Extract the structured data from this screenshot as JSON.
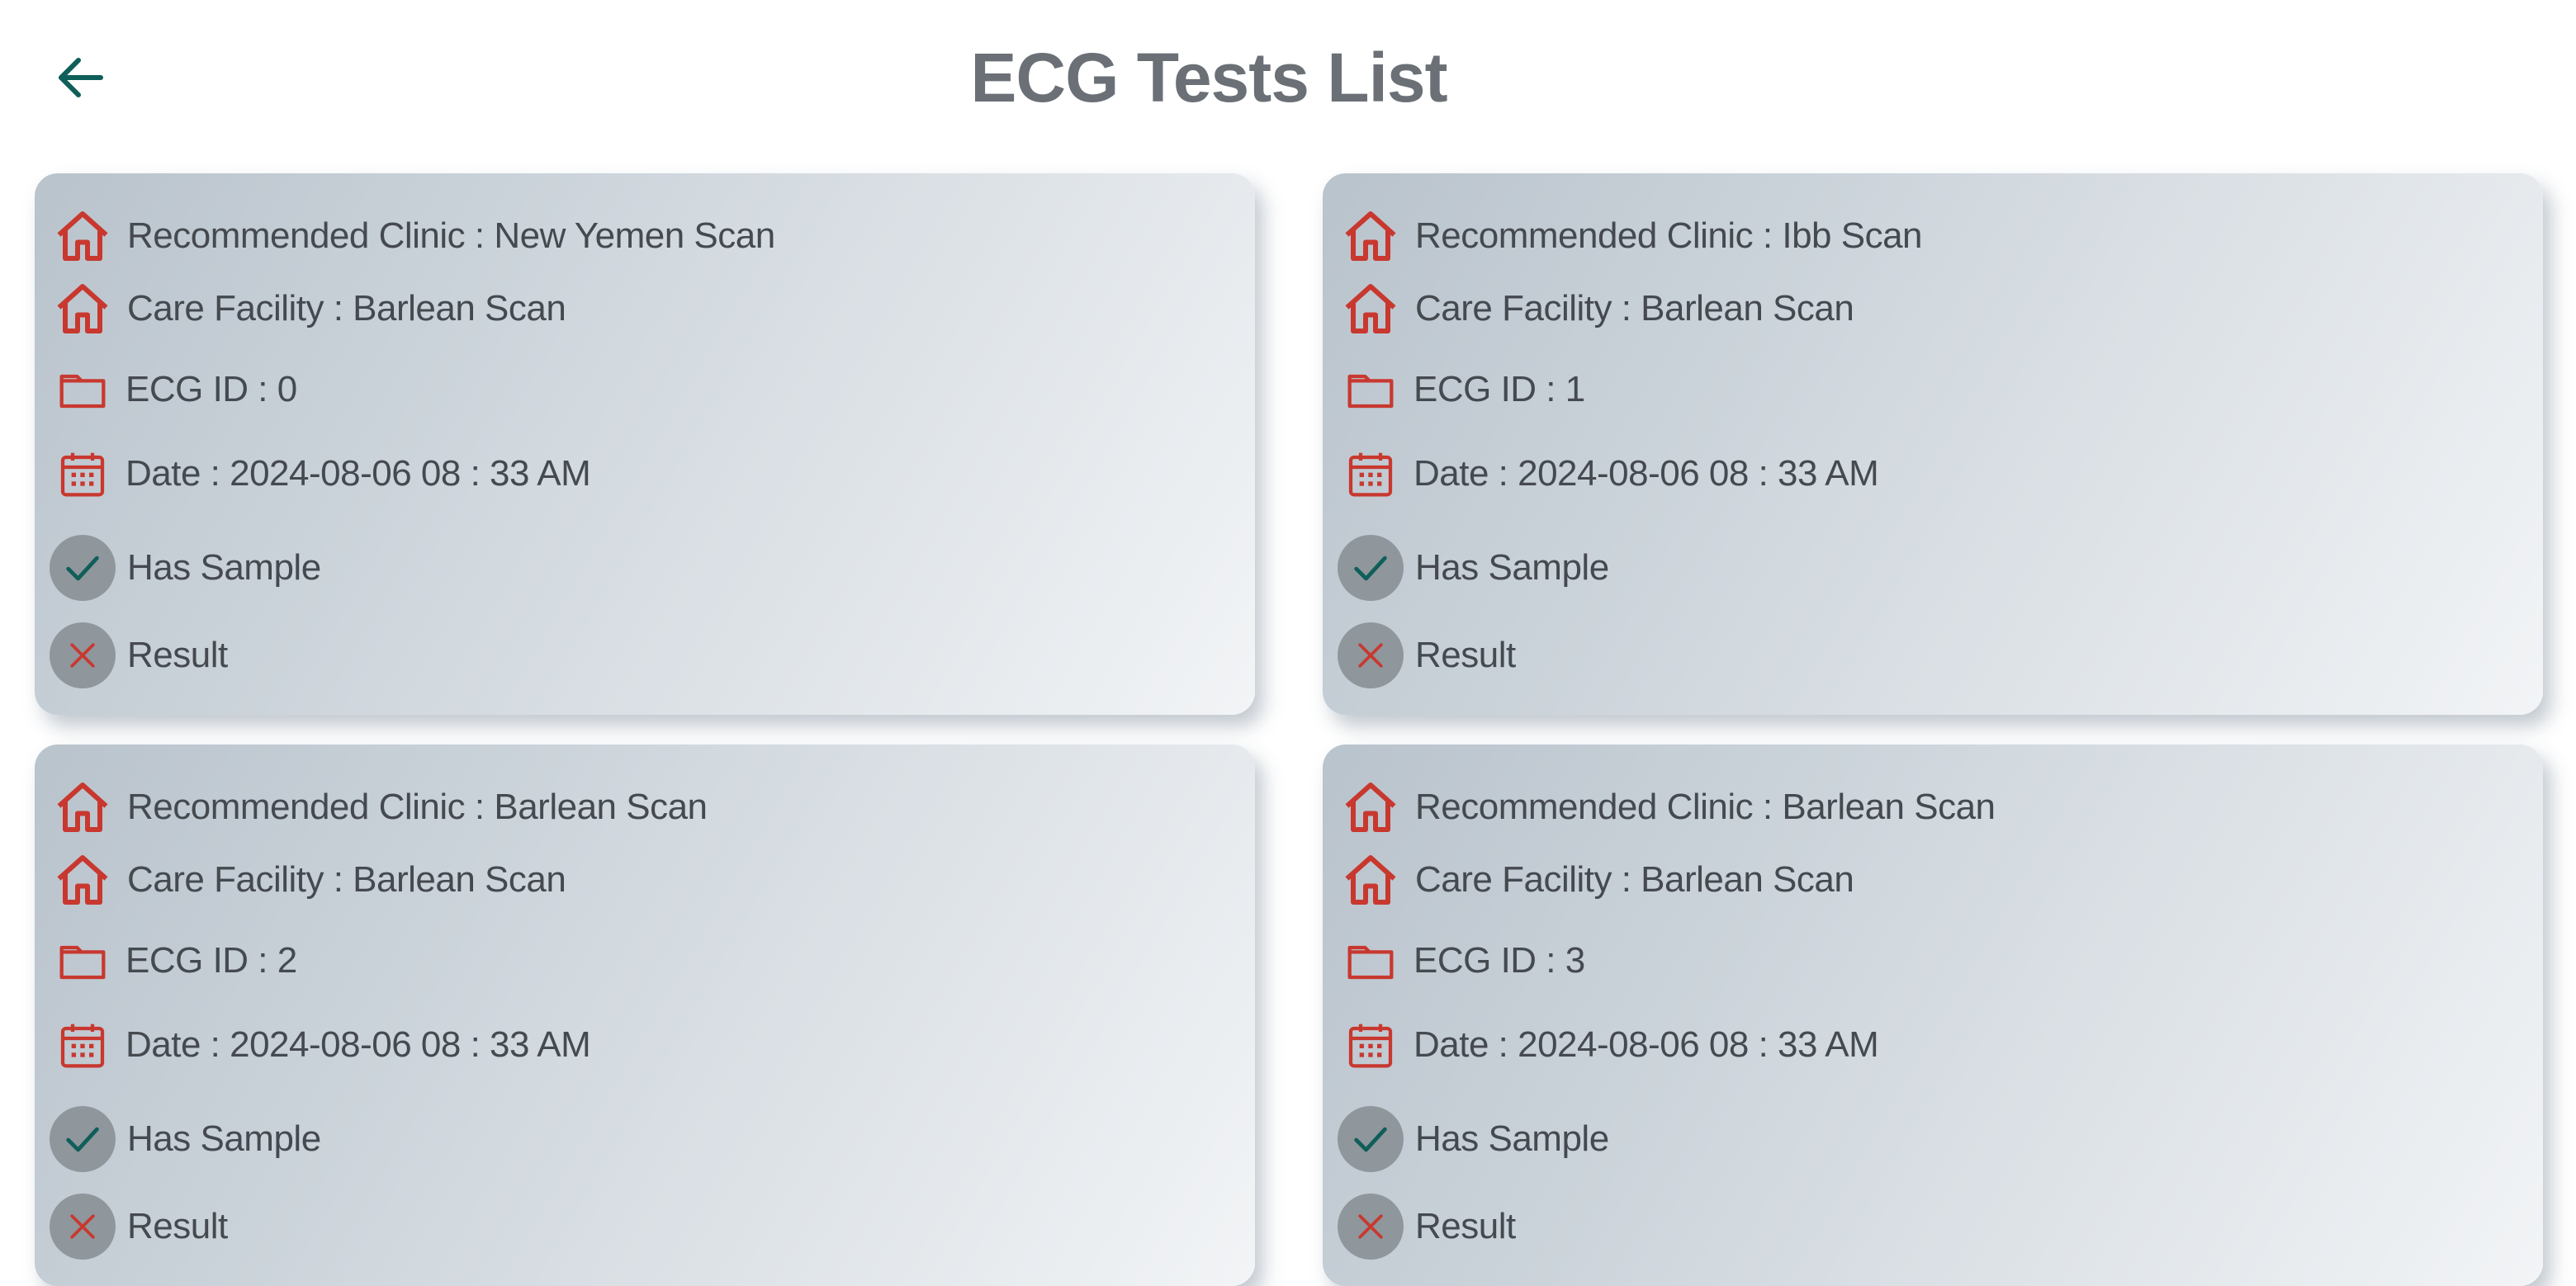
{
  "header": {
    "title": "ECG Tests List",
    "back_icon": "arrow-left-icon"
  },
  "colors": {
    "accent": "#0f5e5a",
    "icon_red": "#c8382f",
    "title": "#6b7076",
    "text": "#454a50",
    "status_circle": "#8f969c"
  },
  "cards": [
    {
      "clinic": "Recommended Clinic : New Yemen Scan",
      "facility": "Care Facility : Barlean Scan",
      "ecg_id": "ECG ID : 0",
      "date": "Date : 2024-08-06  08 : 33 AM",
      "sample": "Has Sample",
      "result": "Result"
    },
    {
      "clinic": "Recommended Clinic : Ibb Scan",
      "facility": "Care Facility : Barlean Scan",
      "ecg_id": "ECG ID : 1",
      "date": "Date : 2024-08-06  08 : 33 AM",
      "sample": "Has Sample",
      "result": "Result"
    },
    {
      "clinic": "Recommended Clinic : Barlean Scan",
      "facility": "Care Facility : Barlean Scan",
      "ecg_id": "ECG ID : 2",
      "date": "Date : 2024-08-06  08 : 33 AM",
      "sample": "Has Sample",
      "result": "Result"
    },
    {
      "clinic": "Recommended Clinic : Barlean Scan",
      "facility": "Care Facility : Barlean Scan",
      "ecg_id": "ECG ID : 3",
      "date": "Date : 2024-08-06  08 : 33 AM",
      "sample": "Has Sample",
      "result": "Result"
    }
  ]
}
